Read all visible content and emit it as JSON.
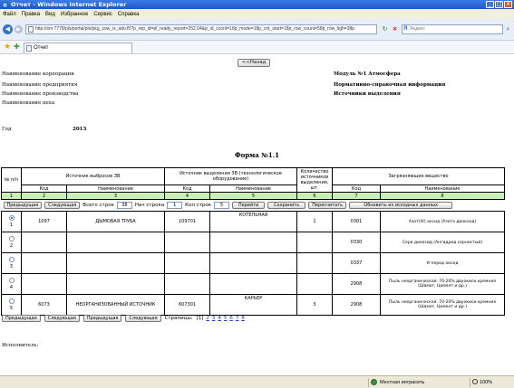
{
  "window": {
    "title": "Отчет - Windows Internet Explorer"
  },
  "menu": [
    "Файл",
    "Правка",
    "Вид",
    "Избранное",
    "Сервис",
    "Справка"
  ],
  "address": {
    "url": "http://srv:7778/pls/portal/pls/pkg_sow_ix_ado.f0?p_rep_id=pl_ready_report=252.04&p_id_ccont=18p_mode=18p_cnt_start=18p_row_count=58p_row_ligh=38p",
    "search_placeholder": "Яндекс"
  },
  "tab": {
    "label": "Отчет"
  },
  "page": {
    "back_button": "<<Назад",
    "left_labels": [
      "Наименование корпорации",
      "Наименование предприятия",
      "Наименование производства",
      "Наименование цеха"
    ],
    "right_labels": [
      "Модуль №1 Атмосфера",
      "Нормативно-справочная информация",
      "Источники выделения"
    ],
    "year_label": "Год",
    "year_value": "2013",
    "form_title": "Форма №1.1",
    "executor_label": "Исполнитель:"
  },
  "table": {
    "header": {
      "num": "№ п/п",
      "group_source": "Источник выбросов ЗВ",
      "group_emission": "Источник выделения ЗВ (технологическое оборудование)",
      "count": "Количество источников выделения, шт.",
      "group_pollutant": "Загрязняющее вещество",
      "code": "Код",
      "name": "Наименование"
    },
    "column_numbers": [
      "1",
      "2",
      "3",
      "4",
      "5",
      "6",
      "7",
      "8"
    ],
    "controls": {
      "prev": "Предыдущая",
      "next": "Следующая",
      "total_rows_label": "Всего строк",
      "total_rows_value": "38",
      "start_row_label": "Нач строка",
      "start_row_value": "1",
      "row_count_label": "Кол строк",
      "row_count_value": "5",
      "go": "Перейти",
      "save": "Сохранить",
      "recalc": "Пересчитать",
      "refresh": "Обновить из исходных данных"
    },
    "rows": [
      {
        "num": "1",
        "selected": true,
        "src_code": "1097",
        "src_name": "ДЫМОВАЯ ТРУБА",
        "em_code": "109701",
        "em_name": "КОТЕЛЬНАЯ",
        "count": "1",
        "pol_code": "0301",
        "pol_name": "Азот(IV) оксид (Азота диоксид)"
      },
      {
        "num": "2",
        "selected": false,
        "src_code": "",
        "src_name": "",
        "em_code": "",
        "em_name": "",
        "count": "",
        "pol_code": "0330",
        "pol_name": "Сера диоксид (Ангидрид сернистый)"
      },
      {
        "num": "3",
        "selected": false,
        "src_code": "",
        "src_name": "",
        "em_code": "",
        "em_name": "",
        "count": "",
        "pol_code": "0337",
        "pol_name": "Углерод оксид"
      },
      {
        "num": "4",
        "selected": false,
        "src_code": "",
        "src_name": "",
        "em_code": "",
        "em_name": "",
        "count": "",
        "pol_code": "2908",
        "pol_name": "Пыль неорганическая: 70-20% двуокиси кремния (Шамот, Цемент и др.)"
      },
      {
        "num": "5",
        "selected": false,
        "src_code": "6073",
        "src_name": "НЕОРГАНИЗОВАННЫЙ ИСТОЧНИК",
        "em_code": "607301",
        "em_name": "КАРЬЕР",
        "count": "3",
        "pol_code": "2908",
        "pol_name": "Пыль неорганическая: 70-20% двуокиси кремния (Шамот, Цемент и др.)"
      }
    ]
  },
  "pager": {
    "prev1": "Предыдущая",
    "next1": "Следующая",
    "prev2": "Предыдущая",
    "next2": "Следующая",
    "pages_label": "Страницы:",
    "current": "[1]",
    "pages": [
      "2",
      "3",
      "4",
      "5",
      "6",
      "7",
      "8"
    ]
  },
  "status": {
    "zone": "Местная интрасеть",
    "zoom": "100%"
  }
}
